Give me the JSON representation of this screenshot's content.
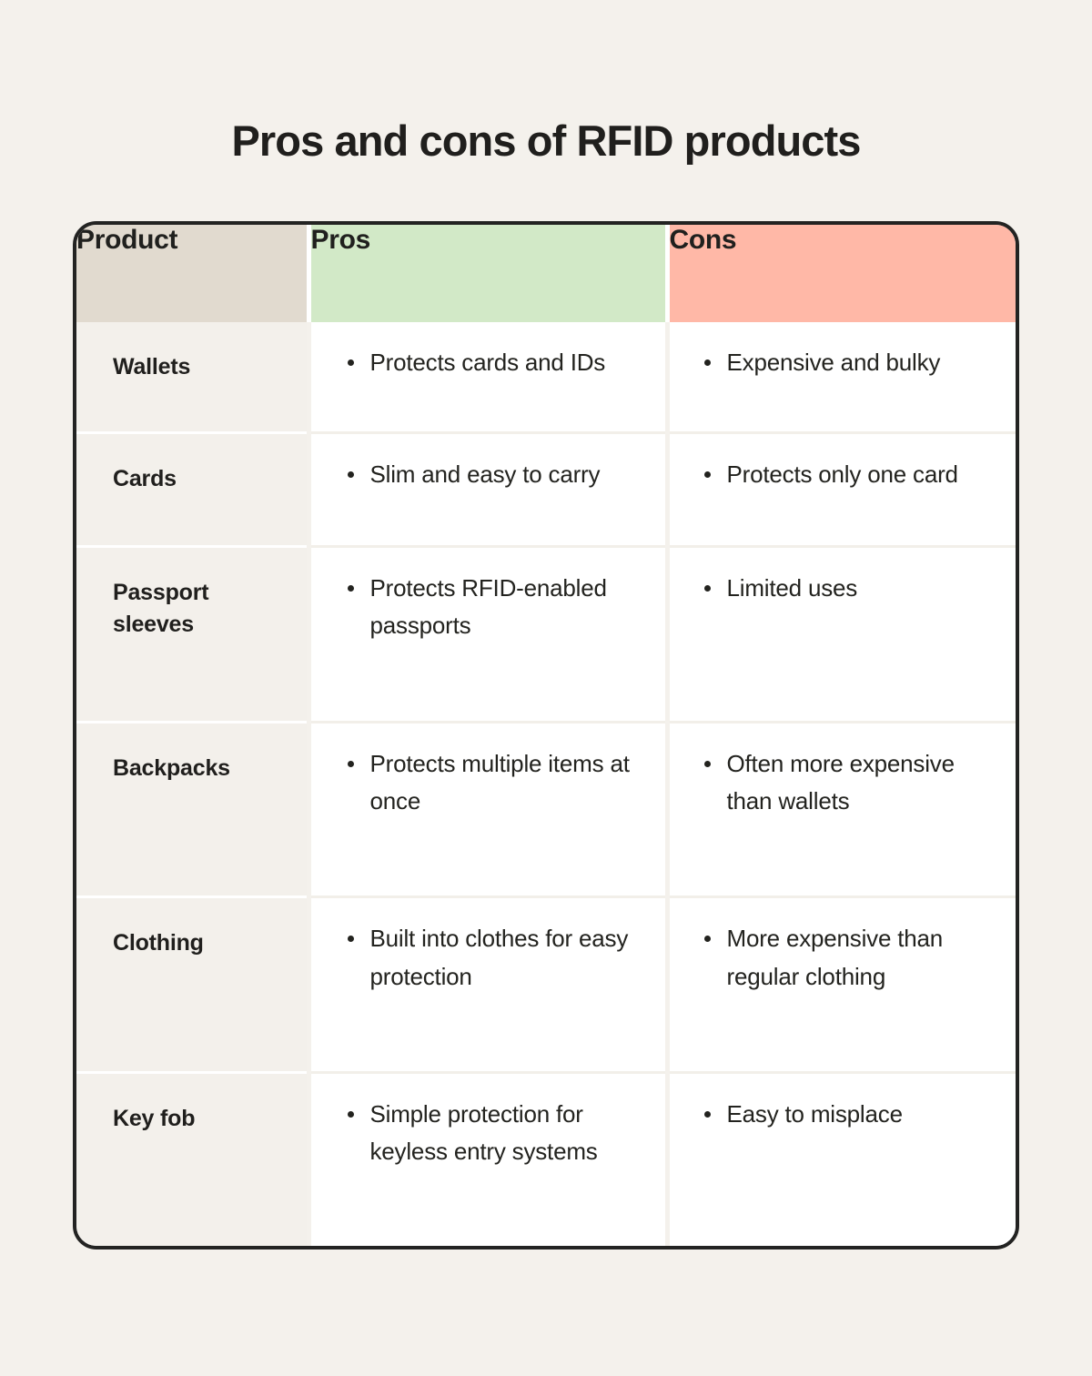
{
  "page": {
    "background_color": "#f4f1ec",
    "text_color": "#23231f"
  },
  "title": "Pros and cons of RFID products",
  "table": {
    "border_color": "#232322",
    "columns": [
      {
        "key": "product",
        "label": "Product",
        "header_color": "#e1dacf",
        "body_color": "#f3f0eb"
      },
      {
        "key": "pros",
        "label": "Pros",
        "header_color": "#d2e9c7",
        "body_color": "#ffffff"
      },
      {
        "key": "cons",
        "label": "Cons",
        "header_color": "#ffb8a7",
        "body_color": "#ffffff"
      }
    ],
    "rows": [
      {
        "product": "Wallets",
        "pros": [
          "Protects cards and IDs"
        ],
        "cons": [
          "Expensive and bulky"
        ]
      },
      {
        "product": "Cards",
        "pros": [
          "Slim and easy to carry"
        ],
        "cons": [
          "Protects only one card"
        ]
      },
      {
        "product": "Passport sleeves",
        "pros": [
          "Protects RFID-enabled passports"
        ],
        "cons": [
          "Limited uses"
        ]
      },
      {
        "product": "Backpacks",
        "pros": [
          "Protects multiple items at once"
        ],
        "cons": [
          "Often more expensive than wallets"
        ]
      },
      {
        "product": "Clothing",
        "pros": [
          "Built into clothes for easy protection"
        ],
        "cons": [
          "More expensive than regular clothing"
        ]
      },
      {
        "product": "Key fob",
        "pros": [
          "Simple protection for keyless entry systems"
        ],
        "cons": [
          "Easy to misplace"
        ]
      }
    ]
  }
}
